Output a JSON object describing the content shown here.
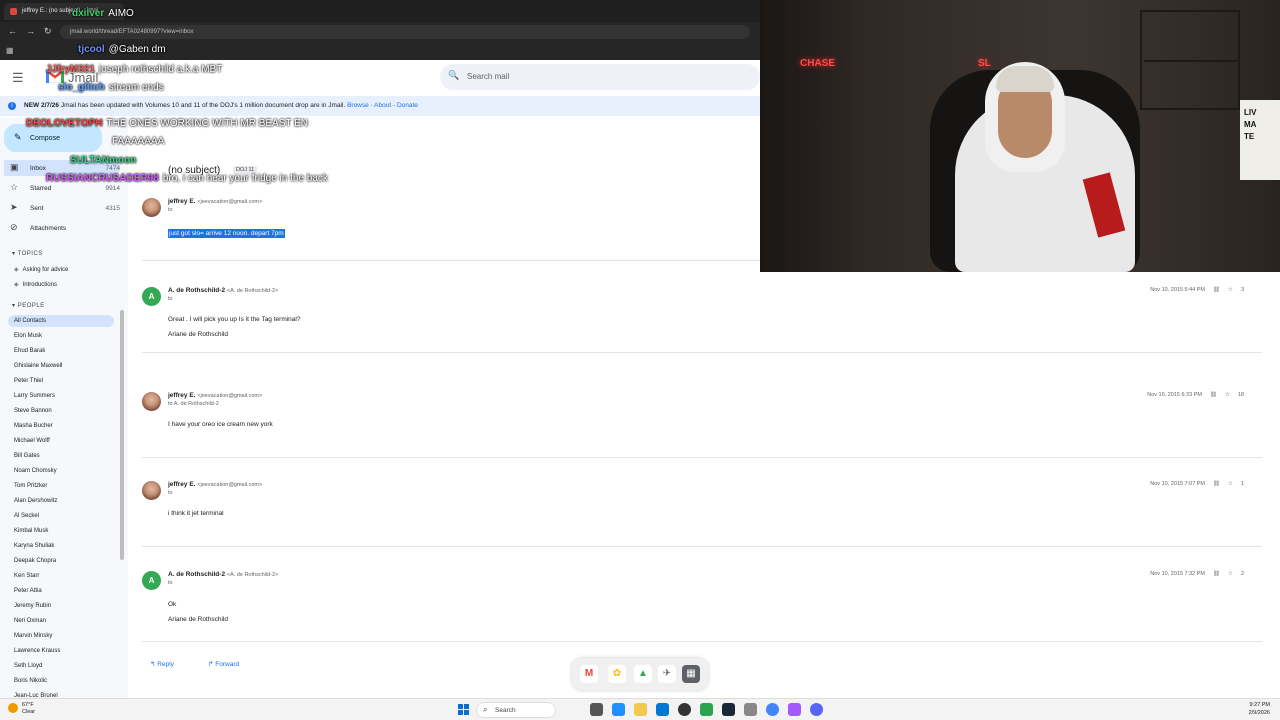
{
  "browser": {
    "tab_title": "jeffrey E.: (no subject) - Jmai...",
    "url": "jmail.world/thread/EFTA02480997?view=inbox"
  },
  "app": {
    "logo_text": "Jmail",
    "search_placeholder": "Search mail"
  },
  "banner": {
    "date": "NEW 2/7/26",
    "text": "Jmail has been updated with Volumes 10 and 11 of the DOJ's 1 million document drop are in Jmail.",
    "browse": "Browse",
    "about": "About",
    "donate": "Donate"
  },
  "sidebar": {
    "compose": "Compose",
    "items": [
      {
        "label": "Inbox",
        "count": "7474"
      },
      {
        "label": "Starred",
        "count": "9914"
      },
      {
        "label": "Sent",
        "count": "4315"
      },
      {
        "label": "Attachments",
        "count": ""
      }
    ],
    "topics_header": "TOPICS",
    "topics": [
      "Asking for advice",
      "Introductions"
    ],
    "people_header": "PEOPLE",
    "people": [
      "All Contacts",
      "Elon Musk",
      "Ehud Barak",
      "Ghislaine Maxwell",
      "Peter Thiel",
      "Larry Summers",
      "Steve Bannon",
      "Masha Bucher",
      "Michael Wolff",
      "Bill Gates",
      "Noam Chomsky",
      "Tom Pritzker",
      "Alan Dershowitz",
      "Al Seckel",
      "Kimbal Musk",
      "Karyna Shuliak",
      "Deepak Chopra",
      "Ken Starr",
      "Peter Attia",
      "Jeremy Rubin",
      "Neri Oxman",
      "Marvin Minsky",
      "Lawrence Krauss",
      "Seth Lloyd",
      "Boris Nikolic",
      "Jean-Luc Brunel"
    ]
  },
  "thread": {
    "subject": "(no subject)",
    "badge": "DOJ 11",
    "messages": [
      {
        "sender": "jeffrey E.",
        "email": "<jeevacation@gmail.com>",
        "to": "to",
        "body": "just got slo= arrive 12 noon. depart 7pm",
        "date": "",
        "count": "",
        "avatar": "photo"
      },
      {
        "sender": "A. de Rothschild-2",
        "email": "<A. de Rothschild-2>",
        "to": "to",
        "body": "Great . I will pick you up Is it the Tag terminal?",
        "body2": "Ariane de Rothschild",
        "date": "Nov 10, 2015 5:44 PM",
        "count": "3",
        "avatar": "A"
      },
      {
        "sender": "jeffrey E.",
        "email": "<jeevacation@gmail.com>",
        "to": "to A. de Rothschild-2",
        "body": "I have your oreo ice cream new york",
        "date": "Nov 10, 2015 6:33 PM",
        "count": "18",
        "avatar": "photo"
      },
      {
        "sender": "jeffrey E.",
        "email": "<jeevacation@gmail.com>",
        "to": "to",
        "body": "i think it jet terminal",
        "date": "Nov 10, 2015 7:07 PM",
        "count": "1",
        "avatar": "photo"
      },
      {
        "sender": "A. de Rothschild-2",
        "email": "<A. de Rothschild-2>",
        "to": "to",
        "body": "Ok",
        "body2": "Ariane de Rothschild",
        "date": "Nov 10, 2015 7:32 PM",
        "count": "2",
        "avatar": "A"
      }
    ],
    "reply": "Reply",
    "forward": "Forward"
  },
  "chat": [
    {
      "user": "dxilver",
      "text": "AIMO",
      "color": "#3cd36a"
    },
    {
      "user": "tjcool",
      "text": "@Gaben dm",
      "color": "#6b8cff"
    },
    {
      "user": "JJfryM321",
      "text": "joseph rothschild a.k.a MBT",
      "color": "#ff5c5c"
    },
    {
      "user": "slo_glitch",
      "text": "stream ends",
      "color": "#5aa0ff"
    },
    {
      "user": "DEOLOVETOPH",
      "text": "THE ONES WORKING WITH MR BEAST EN",
      "color": "#ff4040"
    },
    {
      "user": "",
      "text": "FAAAAAAA",
      "color": "#ffffff"
    },
    {
      "user": "SULTANmoon",
      "text": "",
      "color": "#3ad18a"
    },
    {
      "user": "RUSSIANCRUSADER98",
      "text": "bro, i can hear your fridge in the back",
      "color": "#d65cff"
    }
  ],
  "webcam": {
    "neon1": "CHASE",
    "neon2": "SL",
    "poster_lines": [
      "LIV",
      "MA",
      "TE"
    ]
  },
  "taskbar": {
    "temp": "67°F",
    "condition": "Clear",
    "search": "Search",
    "time": "9:27 PM",
    "date": "2/9/2026"
  }
}
